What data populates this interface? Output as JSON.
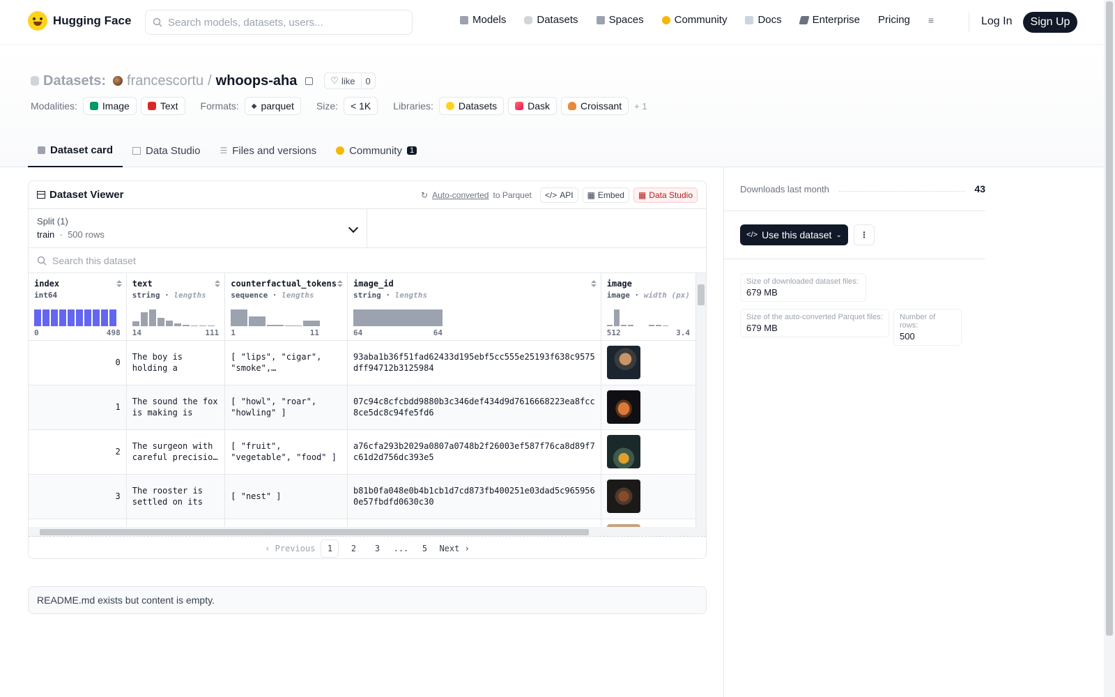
{
  "nav": {
    "brand": "Hugging Face",
    "search_placeholder": "Search models, datasets, users...",
    "links": [
      "Models",
      "Datasets",
      "Spaces",
      "Community",
      "Docs",
      "Enterprise",
      "Pricing"
    ],
    "login": "Log In",
    "signup": "Sign Up"
  },
  "header": {
    "section": "Datasets:",
    "owner": "francescortu",
    "separator": "/",
    "dataset": "whoops-aha",
    "like_label": "like",
    "like_count": "0",
    "modalities_label": "Modalities:",
    "modalities": [
      "Image",
      "Text"
    ],
    "formats_label": "Formats:",
    "format": "parquet",
    "size_label": "Size:",
    "size": "< 1K",
    "libraries_label": "Libraries:",
    "libraries": [
      "Datasets",
      "Dask",
      "Croissant"
    ],
    "more_libraries": "+ 1"
  },
  "tabs": [
    {
      "label": "Dataset card",
      "active": true
    },
    {
      "label": "Data Studio"
    },
    {
      "label": "Files and versions"
    },
    {
      "label": "Community",
      "badge": "1"
    }
  ],
  "viewer": {
    "title": "Dataset Viewer",
    "auto_converted": "Auto-converted",
    "to_parquet": "to Parquet",
    "api": "API",
    "embed": "Embed",
    "data_studio": "Data Studio",
    "split_label": "Split (1)",
    "split_name": "train",
    "split_rows": "500 rows",
    "search_placeholder": "Search this dataset",
    "columns": [
      {
        "name": "index",
        "type": "int64",
        "stat": "",
        "min": "0",
        "max": "498"
      },
      {
        "name": "text",
        "type": "string",
        "stat": "lengths",
        "min": "14",
        "max": "111"
      },
      {
        "name": "counterfactual_tokens",
        "type": "sequence",
        "stat": "lengths",
        "min": "1",
        "max": "11"
      },
      {
        "name": "image_id",
        "type": "string",
        "stat": "lengths",
        "min": "64",
        "max": "64"
      },
      {
        "name": "image",
        "type": "image",
        "stat": "width (px)",
        "min": "512",
        "max": "3.4"
      }
    ],
    "rows": [
      {
        "index": "0",
        "text": "The boy is holding a",
        "tokens": "[ \"lips\", \"cigar\", \"smoke\", \"mouthpiece\", \"pipe\" ]",
        "image_id": "93aba1b36f51fad62433d195ebf5cc555e25193f638c9575dff94712b3125984"
      },
      {
        "index": "1",
        "text": "The sound the fox is making is",
        "tokens": "[ \"howl\", \"roar\", \"howling\" ]",
        "image_id": "07c94c8cfcbdd9880b3c346def434d9d7616668223ea8fcc8ce5dc8c94fe5fd6"
      },
      {
        "index": "2",
        "text": "The surgeon with careful precision is",
        "tokens": "[ \"fruit\", \"vegetable\", \"food\" ]",
        "image_id": "a76cfa293b2029a0807a0748b2f26003ef587f76ca8d89f7c61d2d756dc393e5"
      },
      {
        "index": "3",
        "text": "The rooster is settled on its",
        "tokens": "[ \"nest\" ]",
        "image_id": "b81b0fa048e0b4b1cb1d7cd873fb400251e03dad5c9659560e57fbdfd0630c30"
      }
    ],
    "pager": {
      "previous": "Previous",
      "pages": [
        "1",
        "2",
        "3",
        "...",
        "5"
      ],
      "current": "1",
      "next": "Next"
    }
  },
  "readme": "README.md exists but content is empty.",
  "sidebar": {
    "downloads_label": "Downloads last month",
    "downloads": "43",
    "use_button": "Use this dataset",
    "stats": [
      {
        "label": "Size of downloaded dataset files:",
        "value": "679 MB"
      },
      {
        "label": "Size of the auto-converted Parquet files:",
        "value": "679 MB"
      },
      {
        "label": "Number of rows:",
        "value": "500"
      }
    ]
  },
  "colors": {
    "accent": "#111827",
    "histogram_index": "#6366f1",
    "histogram": "#9ca3af",
    "brand": "#ffd21e"
  }
}
